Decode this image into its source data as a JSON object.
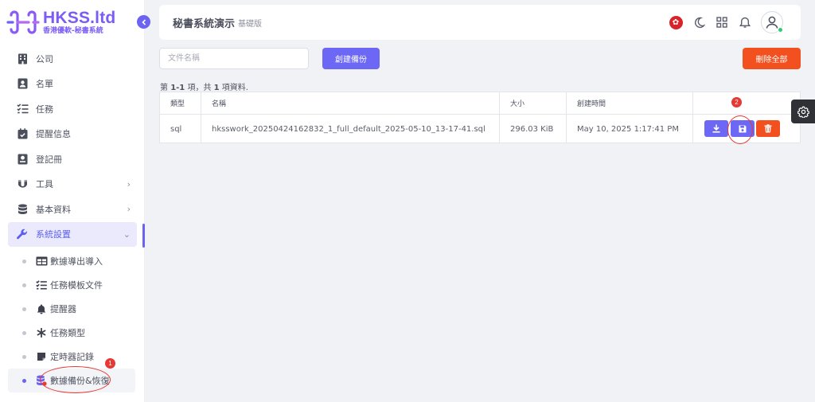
{
  "brand": {
    "name": "HKSS.ltd",
    "subtitle": "香港優軟-秘書系統"
  },
  "sidebar": {
    "items": [
      {
        "label": "公司",
        "icon": "building-icon"
      },
      {
        "label": "名單",
        "icon": "contact-card-icon"
      },
      {
        "label": "任務",
        "icon": "checklist-icon"
      },
      {
        "label": "提醒信息",
        "icon": "calendar-check-icon"
      },
      {
        "label": "登記冊",
        "icon": "register-icon"
      },
      {
        "label": "工具",
        "icon": "magnet-icon",
        "expandable": true
      },
      {
        "label": "基本資料",
        "icon": "database-icon",
        "expandable": true
      },
      {
        "label": "系統設置",
        "icon": "wrench-icon",
        "expandable": true,
        "expanded": true
      }
    ],
    "submenu": [
      {
        "label": "數據導出導入",
        "icon": "table-icon"
      },
      {
        "label": "任務模板文件",
        "icon": "checklist-icon"
      },
      {
        "label": "提醒器",
        "icon": "bell-icon"
      },
      {
        "label": "任務類型",
        "icon": "asterisk-icon"
      },
      {
        "label": "定時器記錄",
        "icon": "sticky-note-icon"
      },
      {
        "label": "數據備份&恢復",
        "icon": "database-restore-icon",
        "current": true
      }
    ]
  },
  "header": {
    "title": "秘書系統演示",
    "edition": "基礎版"
  },
  "toolbar": {
    "search_placeholder": "文件名稱",
    "search_value": "",
    "create_label": "創建備份",
    "delete_all_label": "刪除全部"
  },
  "summary": {
    "prefix": "第 ",
    "range": "1-1",
    "middle": " 項，共 ",
    "total": "1",
    "suffix": " 項資料."
  },
  "table": {
    "headers": [
      "類型",
      "名稱",
      "大小",
      "創建時間",
      ""
    ],
    "rows": [
      {
        "type": "sql",
        "name": "hksswork_20250424162832_1_full_default_2025-05-10_13-17-41.sql",
        "size": "296.03 KiB",
        "created": "May 10, 2025 1:17:41 PM"
      }
    ]
  },
  "annotations": {
    "step1": "1",
    "step2": "2",
    "color": "#e53935"
  },
  "colors": {
    "primary": "#6c67f4",
    "danger": "#f3501f",
    "brand": "#7b5cf6"
  }
}
